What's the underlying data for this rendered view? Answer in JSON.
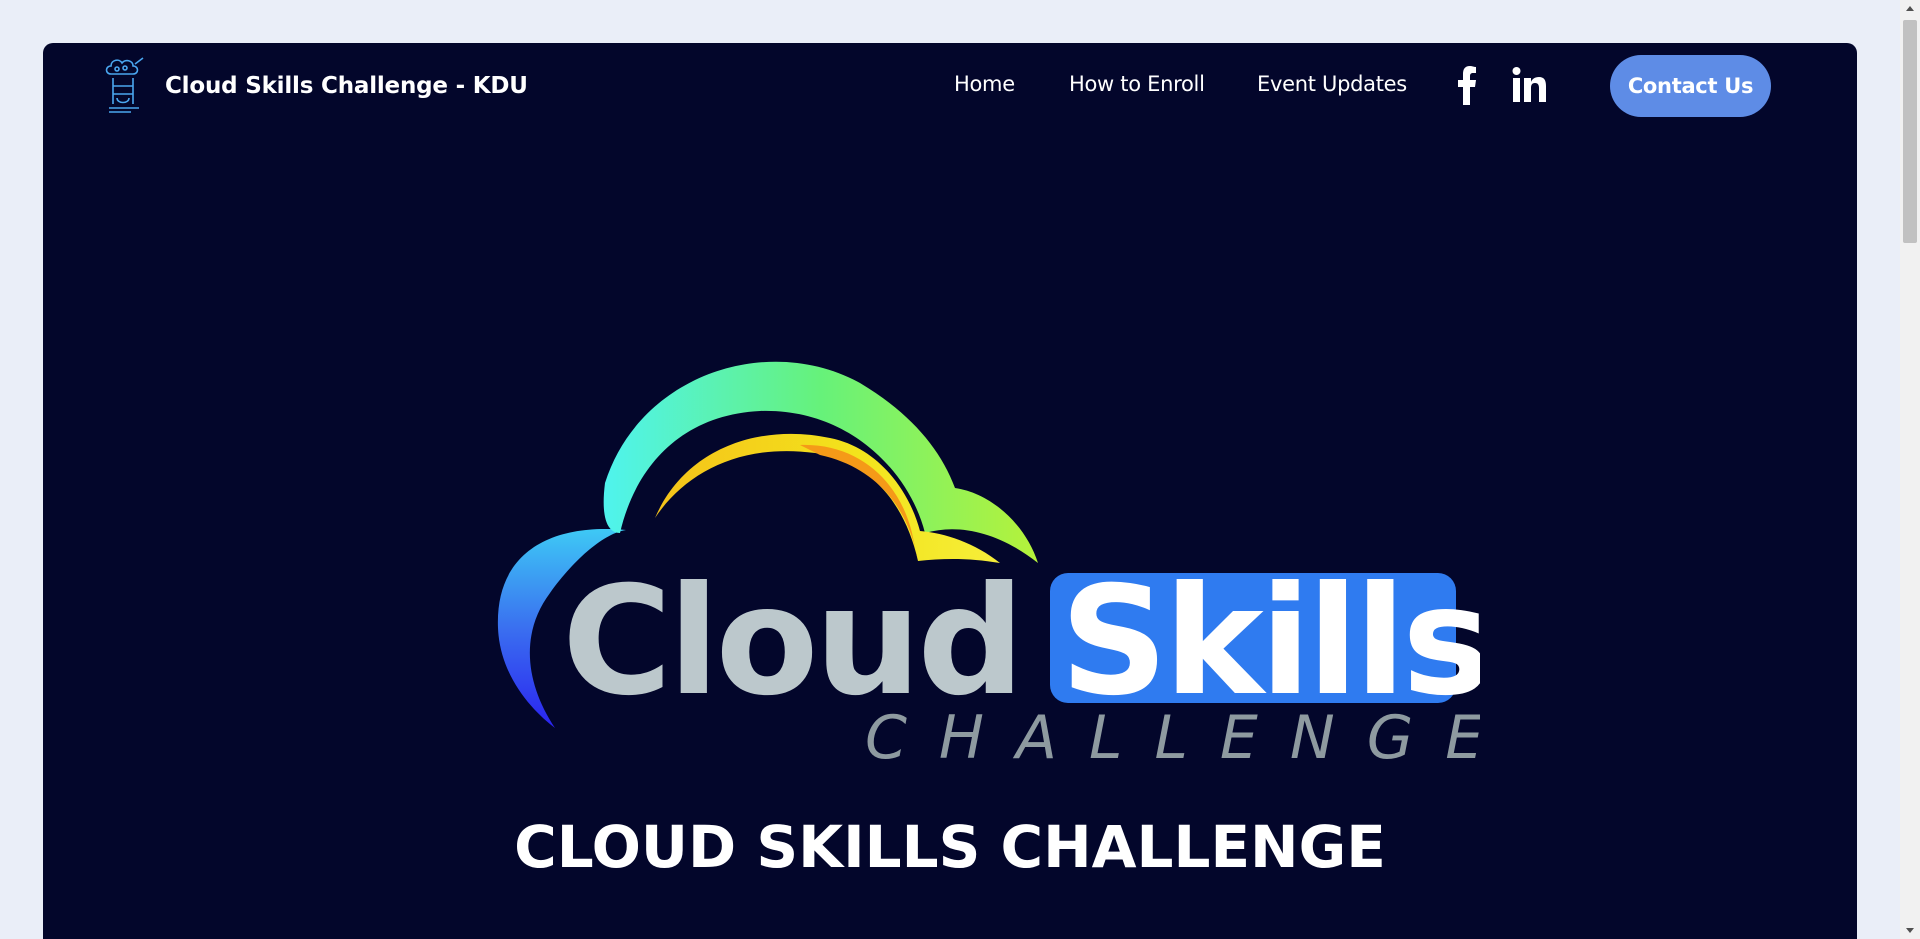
{
  "header": {
    "brand_title": "Cloud Skills Challenge - KDU",
    "nav": [
      {
        "label": "Home"
      },
      {
        "label": "How to Enroll"
      },
      {
        "label": "Event Updates"
      }
    ],
    "social": [
      {
        "icon": "facebook-icon"
      },
      {
        "icon": "linkedin-icon"
      }
    ],
    "contact_label": "Contact Us"
  },
  "hero": {
    "logo_text_cloud": "Cloud",
    "logo_text_skills": "Skills",
    "logo_text_challenge": "CHALLENGE",
    "heading": "CLOUD SKILLS CHALLENGE"
  },
  "colors": {
    "page_bg": "#eaeef8",
    "card_bg": "#03062b",
    "accent": "#5e8ce6",
    "skills_bg": "#2f7bf0",
    "cloud_text": "#bcc8cc",
    "challenge_text": "#8e9aa0"
  }
}
